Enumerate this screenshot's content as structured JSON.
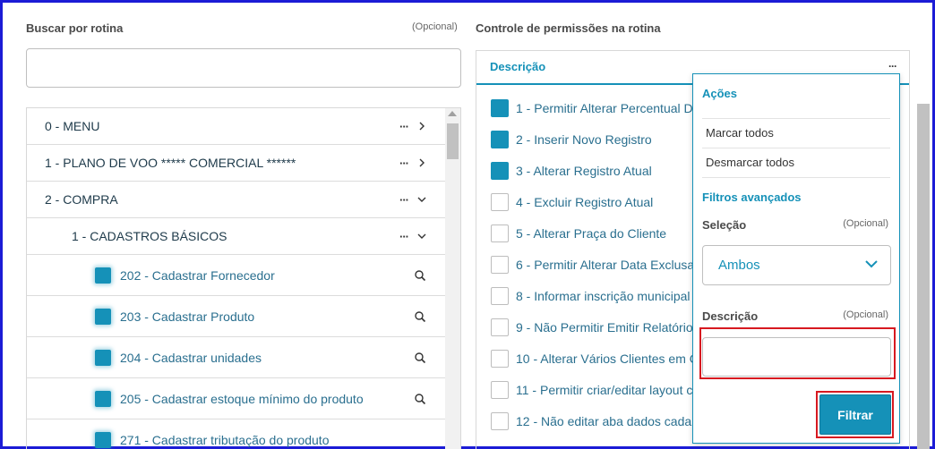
{
  "search": {
    "label": "Buscar por rotina",
    "optional": "(Opcional)",
    "value": ""
  },
  "tree": {
    "rows": [
      {
        "label": "0 - MENU",
        "more": "···"
      },
      {
        "label": "1 - PLANO DE VOO ***** COMERCIAL ******",
        "more": "···"
      },
      {
        "label": "2 - COMPRA",
        "more": "···"
      },
      {
        "label": "1 - CADASTROS BÁSICOS",
        "more": "···"
      }
    ],
    "leaves": [
      {
        "label": "202 - Cadastrar Fornecedor"
      },
      {
        "label": "203 - Cadastrar Produto"
      },
      {
        "label": "204 - Cadastrar unidades"
      },
      {
        "label": "205 - Cadastrar estoque mínimo do produto"
      },
      {
        "label": "271 - Cadastrar tributação do produto"
      }
    ]
  },
  "permissions": {
    "label": "Controle de permissões na rotina",
    "header": "Descrição",
    "header_more": "···",
    "items": [
      {
        "label": "1 - Permitir Alterar Percentual D",
        "checked": true
      },
      {
        "label": "2 - Inserir Novo Registro",
        "checked": true
      },
      {
        "label": "3 - Alterar Registro Atual",
        "checked": true
      },
      {
        "label": "4 - Excluir Registro Atual",
        "checked": false
      },
      {
        "label": "5 - Alterar Praça do Cliente",
        "checked": false
      },
      {
        "label": "6 - Permitir Alterar Data Exclusa",
        "checked": false
      },
      {
        "label": "8 - Informar inscrição municipal",
        "checked": false
      },
      {
        "label": "9 - Não Permitir Emitir Relatório",
        "checked": false
      },
      {
        "label": "10 - Alterar Vários Clientes em C",
        "checked": false
      },
      {
        "label": "11 - Permitir criar/editar layout c",
        "checked": false
      },
      {
        "label": "12 - Não editar aba dados cada",
        "checked": false
      }
    ]
  },
  "popover": {
    "actions_title": "Ações",
    "select_all": "Marcar todos",
    "deselect_all": "Desmarcar todos",
    "filters_title": "Filtros avançados",
    "selection_label": "Seleção",
    "selection_optional": "(Opcional)",
    "selection_value": "Ambos",
    "description_label": "Descrição",
    "description_optional": "(Opcional)",
    "description_value": "",
    "filter_button": "Filtrar"
  },
  "colors": {
    "accent": "#1591b8",
    "highlight": "#d71920",
    "frame": "#1c1cd6"
  }
}
